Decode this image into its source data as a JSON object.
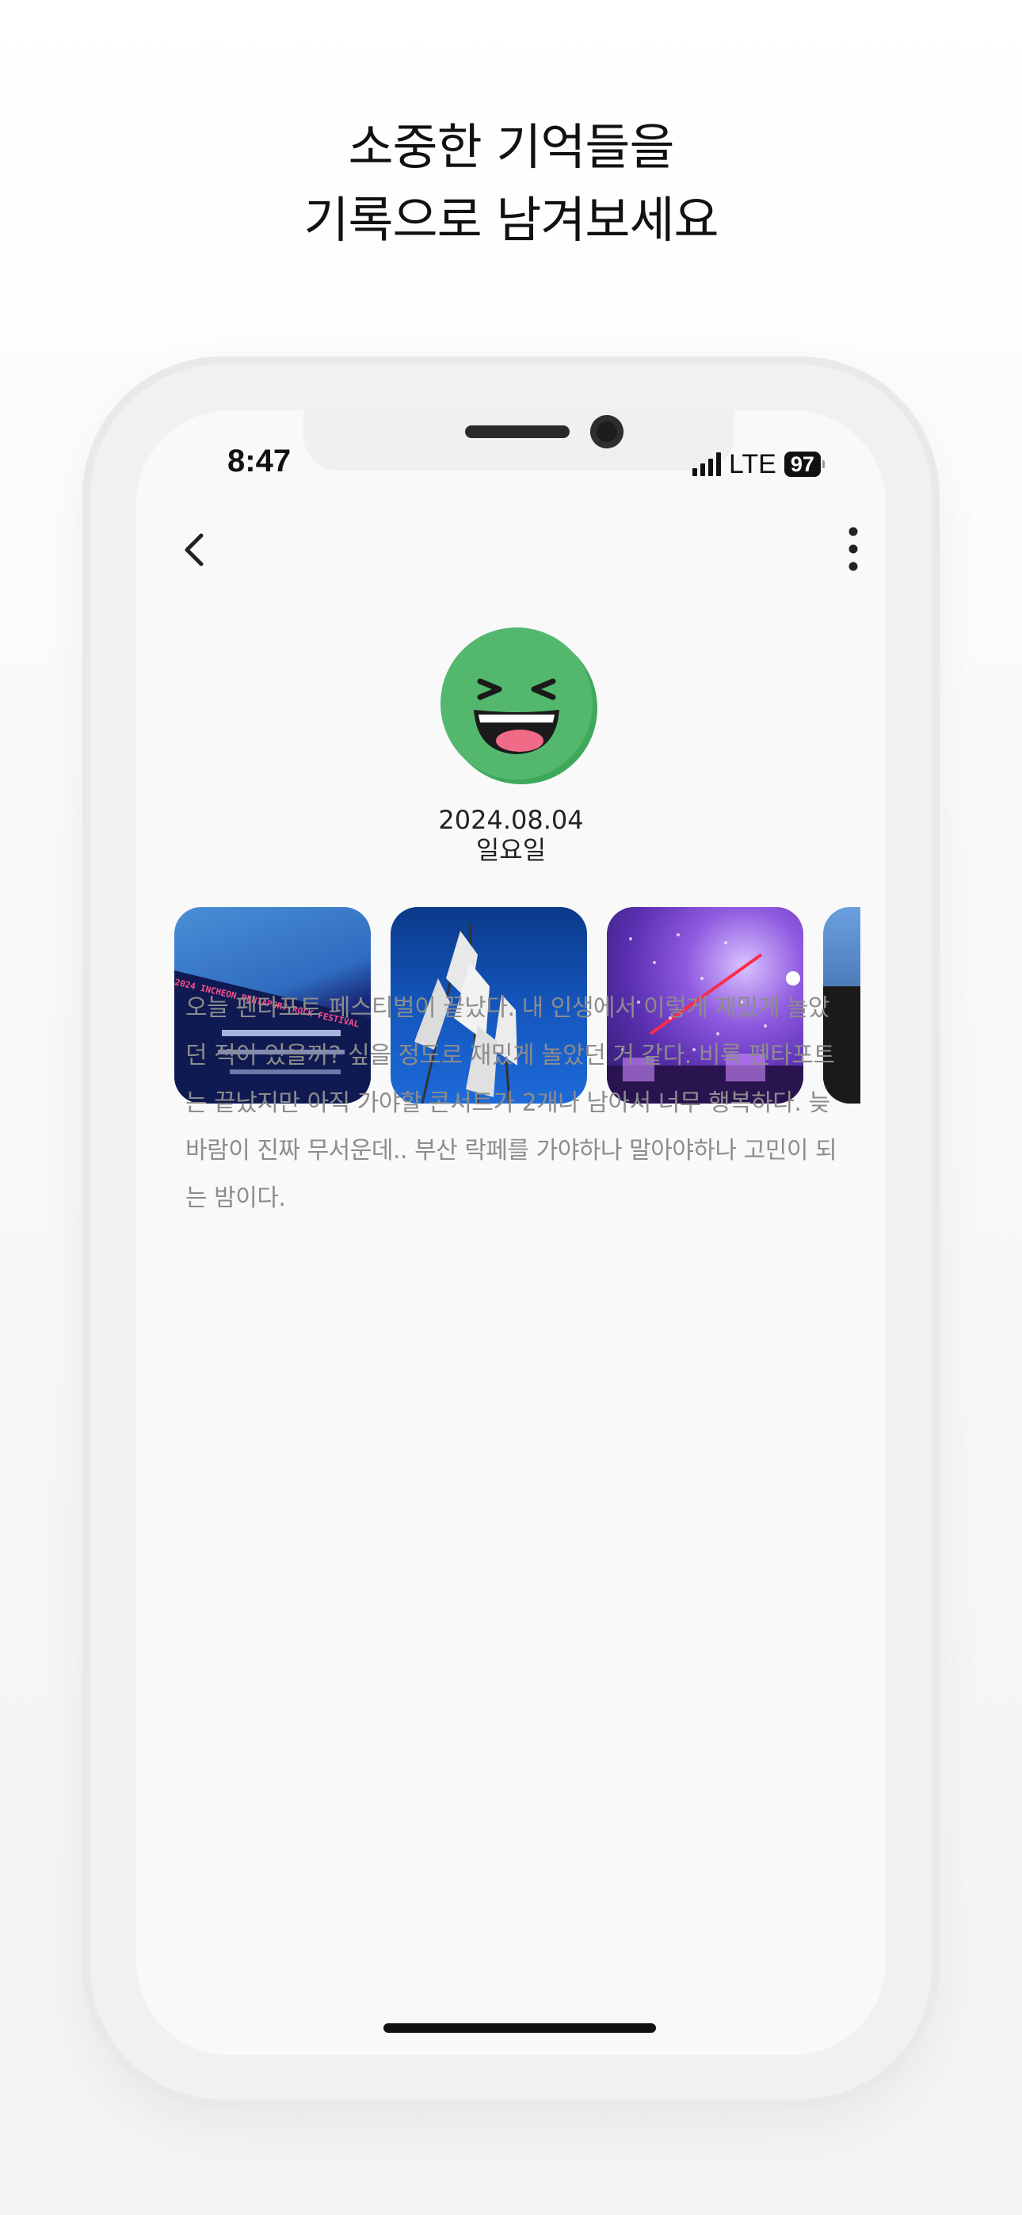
{
  "headline": {
    "line1": "소중한 기억들을",
    "line2": "기록으로 남겨보세요"
  },
  "status_bar": {
    "time": "8:47",
    "network": "LTE",
    "battery": "97"
  },
  "toolbar": {
    "back_icon": "chevron-left-icon",
    "more_icon": "more-vertical-icon"
  },
  "entry": {
    "mood_icon": "laughing-face-icon",
    "mood_color": "#53b86e",
    "date": "2024.08.04",
    "weekday": "일요일",
    "photos": [
      {
        "caption": "2024 INCHEON PENTAPORT ROCK FESTIVAL"
      },
      {
        "caption": ""
      },
      {
        "caption": ""
      },
      {
        "caption": ""
      }
    ],
    "text": "오늘 펜타포트 페스티벌이 끝났다. 내 인생에서 이렇게 재밌게 놀았던 적이 있을까? 싶을 정도로 재밌게 놀았던 거 같다. 비록 펜타포트는 끝났지만 아직 가야할 콘서트가 2개나 남아서 너무 행복하다. 늦바람이 진짜 무서운데.. 부산 락페를 가야하나 말아야하나 고민이 되는 밤이다."
  }
}
